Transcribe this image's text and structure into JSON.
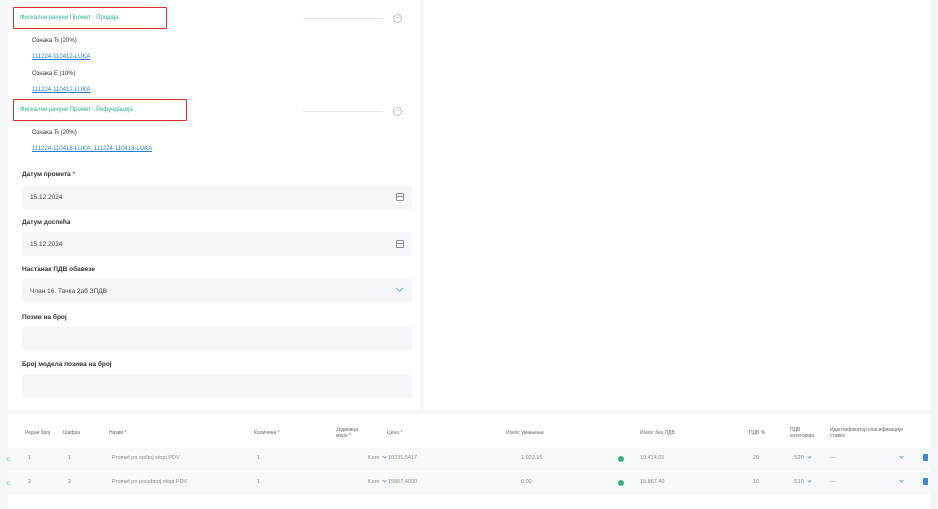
{
  "sections": [
    {
      "title": "Фискални рачуни Промет - Продаја",
      "groups": [
        {
          "tax": "Ознака Ђ (20%)",
          "refs": "111224-110412-LUKA"
        },
        {
          "tax": "Ознака Е (10%)",
          "refs": "111224-110412-LUKA"
        }
      ]
    },
    {
      "title": "Фискални рачуни Промет - Рефундација",
      "groups": [
        {
          "tax": "Ознака Ђ (20%)",
          "refs": "111224-110418-LUKA, 111224-110418-LUKA"
        }
      ]
    }
  ],
  "form": {
    "turnover_date_label": "Датум промета",
    "turnover_date": "15.12.2024",
    "due_date_label": "Датум доспећа",
    "due_date": "15.12.2024",
    "vat_label": "Настанак ПДВ обавезе",
    "vat_value": "Члан 16. Тачка 2аб ЗПДВ",
    "ref_number_label": "Позив на број",
    "ref_number": "",
    "ref_model_label": "Број модела позива на број",
    "ref_model": ""
  },
  "table": {
    "headers": [
      "Редни број",
      "Шифра",
      "Назив *",
      "Количина *",
      "Јединица мере *",
      "Цена *",
      "Износ умањења",
      "Износ без ПДВ",
      "ПДВ %",
      "ПДВ категорија",
      "Идентификатор класификације ставке"
    ],
    "rows": [
      {
        "no": "1",
        "code": "1",
        "name": "Promet po opštoj stopi PDV",
        "qty": "1",
        "unit": "Kom",
        "price": "10231,5417",
        "discount": "1.023,15",
        "net": "19.424,01",
        "vat": "20",
        "cat": "S20",
        "ident": "—"
      },
      {
        "no": "2",
        "code": "2",
        "name": "Promet po posebnoj stopi PDV",
        "qty": "1",
        "unit": "Kom",
        "price": "15867,4000",
        "discount": "0,00",
        "net": "15.867,40",
        "vat": "10",
        "cat": "S10",
        "ident": "—"
      }
    ]
  },
  "colors": {
    "accent": "#2db391",
    "highlight": "#d9302c",
    "link": "#2a7bd4"
  }
}
